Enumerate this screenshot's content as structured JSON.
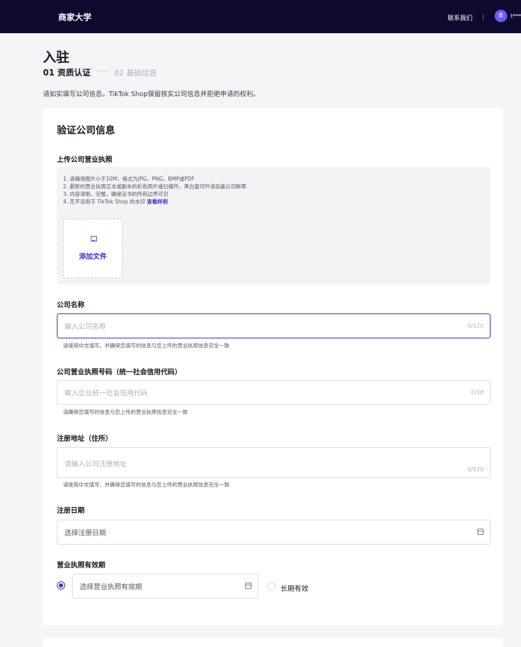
{
  "header": {
    "brand": "商家大学",
    "contact": "联系我们",
    "avatar_glyph": "B",
    "user": "t***"
  },
  "page": {
    "title": "入驻",
    "steps": [
      {
        "label": "01 资质认证",
        "active": true
      },
      {
        "label": "02 基础信息",
        "active": false
      }
    ],
    "notice": "请如实填写公司信息。TikTok Shop保留核实公司信息并拒绝申请的权利。"
  },
  "form": {
    "title": "验证公司信息",
    "license_upload": {
      "label": "上传公司营业执照",
      "requirements": [
        "1. 请确保图片小于10M，格式为JPG，PNG，BMP或PDF",
        "2. 最新的营业执照正本或副本的彩色照片或扫描件，黑白复印件请加盖公司鲜章",
        "3. 内容清晰，完整，确保证书的所有边界可见",
        "4. 无不适用于 TikTok Shop 的水印"
      ],
      "sample_link": "查看样例",
      "add_file": "添加文件"
    },
    "company_name": {
      "label": "公司名称",
      "placeholder": "输入公司名称",
      "count": "0/120",
      "help": "请使用中文填写，并确保您填写的信息与您上传的营业执照信息完全一致"
    },
    "license_number": {
      "label": "公司营业执照号码（统一社会信用代码）",
      "placeholder": "输入企业统一社会信用代码",
      "count": "0/18",
      "help": "请确保您填写的信息与您上传的营业执照信息完全一致"
    },
    "address": {
      "label": "注册地址（住所）",
      "placeholder": "请输入公司注册地址",
      "count": "0/120",
      "help": "请使用中文填写，并确保您填写的信息与您上传的营业执照信息完全一致"
    },
    "reg_date": {
      "label": "注册日期",
      "placeholder": "选择注册日期"
    },
    "validity": {
      "label": "营业执照有效期",
      "date_placeholder": "选择营业执照有效期",
      "long_term": "长期有效"
    }
  },
  "colors": {
    "header_bg": "#0d0a2e",
    "accent": "#3d2bd4",
    "avatar": "#6b5cf6"
  }
}
